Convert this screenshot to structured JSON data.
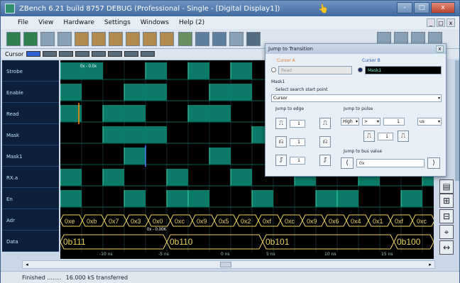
{
  "window": {
    "title": "ZBench 6.21 build 8757 DEBUG (Professional - Single - [Digital Display1])",
    "controls": [
      "-",
      "□",
      "x"
    ]
  },
  "menu": [
    "File",
    "View",
    "Hardware",
    "Settings",
    "Windows",
    "Help (2)"
  ],
  "cursorbar": {
    "label": "Cursor"
  },
  "signals": [
    "Strobe",
    "Enable",
    "Read",
    "Mask",
    "Mask1",
    "RX.a",
    "En",
    "Adr",
    "Data"
  ],
  "adr_values": [
    "0xe",
    "0xb",
    "0x7",
    "0x3",
    "0x0",
    "0xc",
    "0x9",
    "0x5",
    "0x2",
    "0xf",
    "0xc",
    "0x9",
    "0x6",
    "0x4",
    "0x1",
    "0xf",
    "0xc"
  ],
  "data_values": [
    "0b111",
    "0b110",
    "0b101",
    "0b100"
  ],
  "time_ticks": [
    "-10 ns",
    "-5 ns",
    "0 ns",
    "5 ns",
    "10 ns",
    "15 ns"
  ],
  "annotations": {
    "top": "0x - 0.0x",
    "mid": "0x - 0.00K"
  },
  "dialog": {
    "title": "Jump to Transition",
    "cursor_a": "Cursor A",
    "cursor_b": "Cursor B",
    "opt_a": "Read",
    "opt_b": "Mask1",
    "signal": "Mask1",
    "search_label": "Select search start point",
    "search_value": "Cursor",
    "jump_edge": "Jump to edge",
    "jump_pulse": "Jump to pulse",
    "jump_bus": "Jump to bus value",
    "edge_counts": [
      "1",
      "1",
      "1"
    ],
    "pulse_level": "High",
    "pulse_op": ">",
    "pulse_value": "1",
    "pulse_unit": "us",
    "pulse_count": "1",
    "bus_field": "0x"
  },
  "status": {
    "left": "Finished ........",
    "right": "16.000 kS transferred"
  },
  "colors": {
    "wave": "#0d8f7a",
    "bg": "#000000",
    "bus": "#e8d060",
    "marker": "#ff8c00"
  }
}
